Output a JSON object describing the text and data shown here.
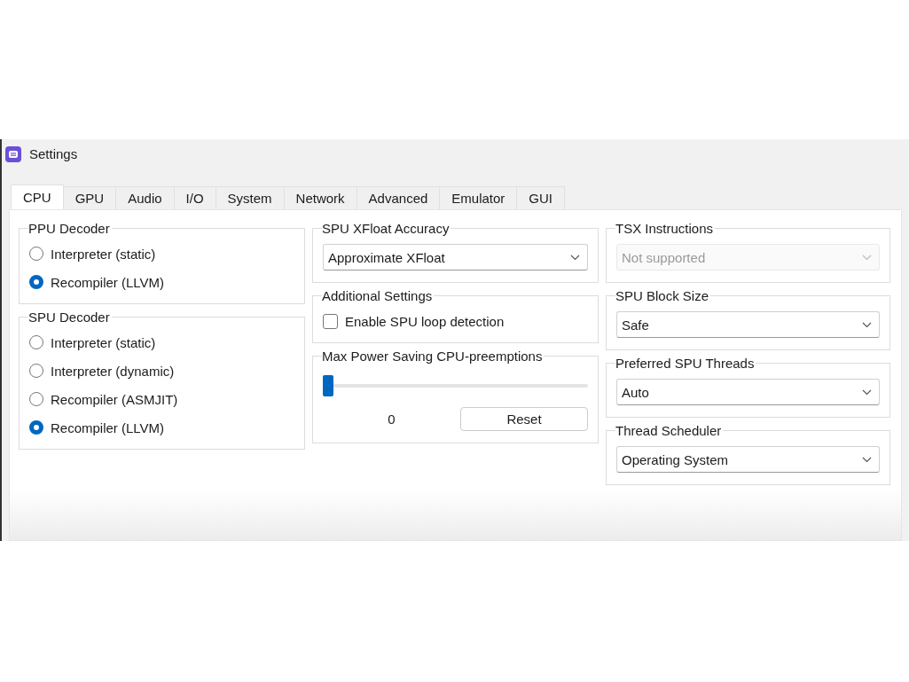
{
  "window": {
    "title": "Settings"
  },
  "tabs": [
    {
      "label": "CPU",
      "selected": true
    },
    {
      "label": "GPU",
      "selected": false
    },
    {
      "label": "Audio",
      "selected": false
    },
    {
      "label": "I/O",
      "selected": false
    },
    {
      "label": "System",
      "selected": false
    },
    {
      "label": "Network",
      "selected": false
    },
    {
      "label": "Advanced",
      "selected": false
    },
    {
      "label": "Emulator",
      "selected": false
    },
    {
      "label": "GUI",
      "selected": false
    }
  ],
  "columns": [
    [
      {
        "kind": "radio",
        "title": "PPU Decoder",
        "options": [
          {
            "label": "Interpreter (static)",
            "selected": false
          },
          {
            "label": "Recompiler (LLVM)",
            "selected": true
          }
        ]
      },
      {
        "kind": "radio",
        "title": "SPU Decoder",
        "options": [
          {
            "label": "Interpreter (static)",
            "selected": false
          },
          {
            "label": "Interpreter (dynamic)",
            "selected": false
          },
          {
            "label": "Recompiler (ASMJIT)",
            "selected": false
          },
          {
            "label": "Recompiler (LLVM)",
            "selected": true
          }
        ]
      }
    ],
    [
      {
        "kind": "dropdown",
        "title": "SPU XFloat Accuracy",
        "value": "Approximate XFloat",
        "disabled": false
      },
      {
        "kind": "checkbox",
        "title": "Additional Settings",
        "label": "Enable SPU loop detection",
        "checked": false
      },
      {
        "kind": "slider",
        "title": "Max Power Saving CPU-preemptions",
        "level": 0,
        "reading": "0",
        "button": "Reset"
      }
    ],
    [
      {
        "kind": "dropdown",
        "title": "TSX Instructions",
        "value": "Not supported",
        "disabled": true
      },
      {
        "kind": "dropdown",
        "title": "SPU Block Size",
        "value": "Safe",
        "disabled": false
      },
      {
        "kind": "dropdown",
        "title": "Preferred SPU Threads",
        "value": "Auto",
        "disabled": false
      },
      {
        "kind": "dropdown",
        "title": "Thread Scheduler",
        "value": "Operating System",
        "disabled": false
      }
    ]
  ]
}
